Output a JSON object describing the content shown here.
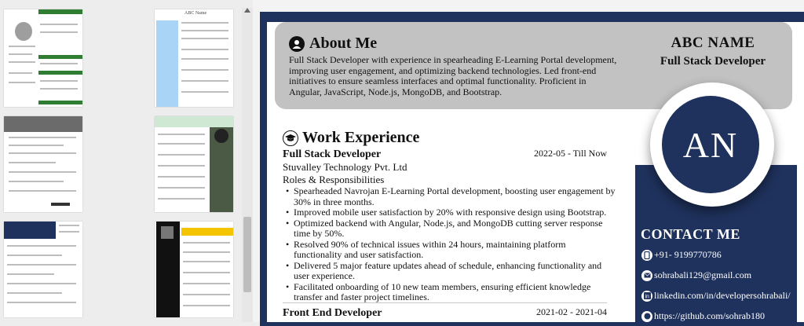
{
  "thumbnails": [
    {
      "id": "t1",
      "name": ""
    },
    {
      "id": "t2",
      "name": "ABC Name"
    },
    {
      "id": "t3",
      "name": ""
    },
    {
      "id": "t4",
      "name": ""
    },
    {
      "id": "t5",
      "name": ""
    },
    {
      "id": "t6",
      "name": ""
    }
  ],
  "about": {
    "title": "About Me",
    "text": "Full Stack Developer with experience in spearheading E-Learning Portal development, improving user engagement, and optimizing backend technologies. Led front-end initiatives to ensure seamless interfaces and optimal functionality. Proficient in Angular, JavaScript, Node.js, MongoDB, and Bootstrap."
  },
  "profile": {
    "name": "ABC NAME",
    "role": "Full Stack Developer",
    "initials": "AN"
  },
  "contact": {
    "title": "CONTACT ME",
    "phone": "+91- 9199770786",
    "email": "sohrabali129@gmail.com",
    "linkedin": "linkedin.com/in/developersohrabali/",
    "github": "https://github.com/sohrab180"
  },
  "work": {
    "title": "Work Experience",
    "jobs": [
      {
        "title": "Full Stack Developer",
        "date": "2022-05 - Till Now",
        "company": "Stuvalley Technology Pvt. Ltd",
        "roles_label": "Roles & Responsibilities",
        "bullets": [
          "Spearheaded Navrojan E-Learning Portal development, boosting user engagement by 30% in three months.",
          "Improved mobile user satisfaction by 20% with responsive design using Bootstrap.",
          "Optimized backend with Angular, Node.js, and MongoDB cutting server response time by 50%.",
          "Resolved 90% of technical issues within 24 hours, maintaining platform functionality and user satisfaction.",
          "Delivered 5 major feature updates ahead of schedule, enhancing functionality and user experience.",
          "Facilitated onboarding of 10 new team members, ensuring efficient knowledge transfer and faster project timelines."
        ]
      },
      {
        "title": "Front End Developer",
        "date": "2021-02 - 2021-04"
      }
    ]
  }
}
